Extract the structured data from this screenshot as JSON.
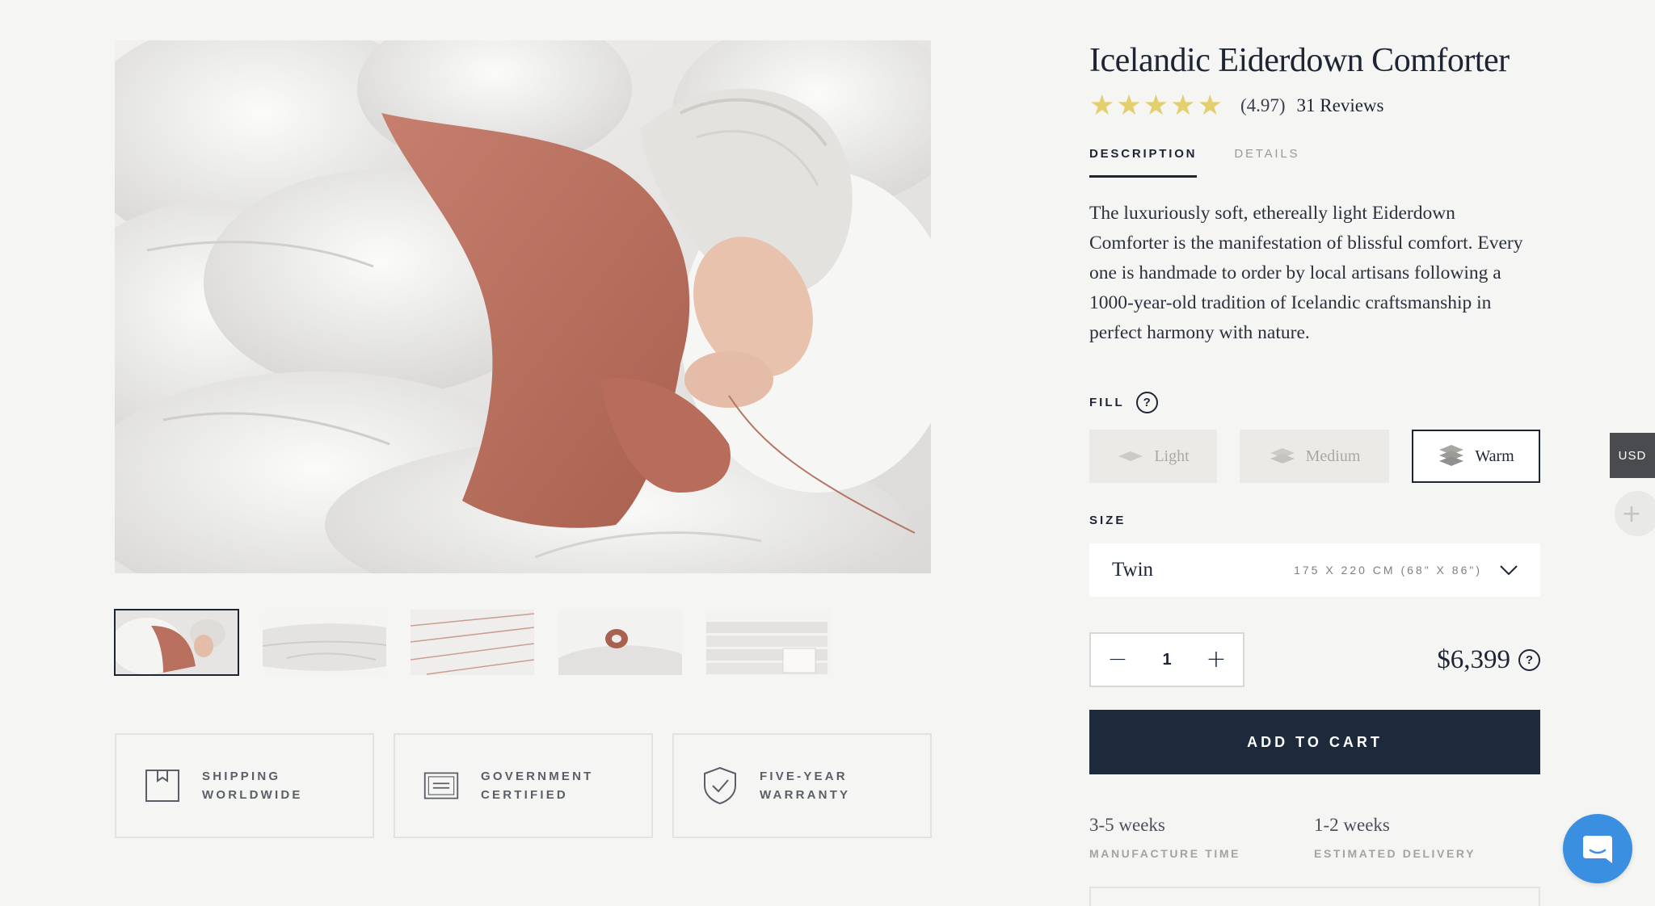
{
  "gallery": {
    "main_image_alt": "",
    "thumbnails": [
      {
        "name": "thumb-sleeping",
        "active": true
      },
      {
        "name": "thumb-folded",
        "active": false
      },
      {
        "name": "thumb-stitching",
        "active": false
      },
      {
        "name": "thumb-piping",
        "active": false
      },
      {
        "name": "thumb-stack",
        "active": false
      }
    ]
  },
  "features": [
    {
      "icon": "box-icon",
      "line1": "SHIPPING",
      "line2": "WORLDWIDE"
    },
    {
      "icon": "certificate-icon",
      "line1": "GOVERNMENT",
      "line2": "CERTIFIED"
    },
    {
      "icon": "shield-check-icon",
      "line1": "FIVE-YEAR",
      "line2": "WARRANTY"
    }
  ],
  "product": {
    "title": "Icelandic Eiderdown Comforter",
    "stars": "★★★★★",
    "rating": "(4.97)",
    "reviews": "31 Reviews",
    "tabs": [
      {
        "label": "DESCRIPTION",
        "active": true
      },
      {
        "label": "DETAILS",
        "active": false
      }
    ],
    "description": "The luxuriously soft, ethereally light Eiderdown Comforter is the manifestation of blissful comfort. Every one is handmade to order by local artisans following a 1000-year-old tradition of Icelandic craftsmanship in perfect harmony with nature.",
    "fill_label": "FILL",
    "help": "?",
    "fill_options": [
      {
        "label": "Light",
        "selected": false
      },
      {
        "label": "Medium",
        "selected": false
      },
      {
        "label": "Warm",
        "selected": true
      }
    ],
    "size_label": "SIZE",
    "size": {
      "name": "Twin",
      "dims": "175 X 220 CM (68\" X 86\")"
    },
    "quantity": "1",
    "minus": "−",
    "plus": "+",
    "price": "$6,399",
    "add_to_cart": "ADD TO CART",
    "manufacture": {
      "value": "3-5 weeks",
      "label": "MANUFACTURE TIME"
    },
    "delivery": {
      "value": "1-2 weeks",
      "label": "ESTIMATED DELIVERY"
    }
  },
  "floating": {
    "currency": "USD",
    "add": "+"
  },
  "colors": {
    "background": "#f5f5f3",
    "navy": "#1c2a3c",
    "star": "#e3cf6e",
    "chat": "#3a8fe0"
  }
}
